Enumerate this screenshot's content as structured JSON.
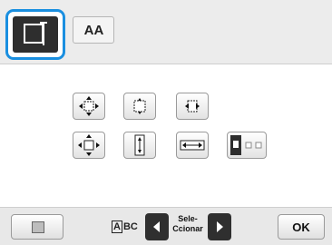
{
  "tabs": {
    "layout_tab": {
      "icon": "layout-frame-icon",
      "selected": true,
      "highlight_color": "#1a8fe0"
    },
    "font_tab": {
      "label": "AA",
      "icon": "font-style-icon"
    }
  },
  "edit_buttons": [
    {
      "name": "move-center-button",
      "icon": "move-all-directions-icon"
    },
    {
      "name": "move-horizontal-button",
      "icon": "move-left-right-icon"
    },
    {
      "name": "move-horizontal-button-2",
      "icon": "move-left-right-icon"
    },
    {
      "name": "expand-all-button",
      "icon": "expand-all-directions-icon"
    },
    {
      "name": "stretch-vertical-button",
      "icon": "stretch-vertical-icon"
    },
    {
      "name": "stretch-horizontal-button",
      "icon": "stretch-horizontal-icon"
    },
    {
      "name": "array-button",
      "icon": "array-arrange-icon"
    }
  ],
  "bottom": {
    "abc_a": "A",
    "abc_bc": "BC",
    "select_line1": "Sele-",
    "select_line2": "Ccionar",
    "ok_label": "OK"
  }
}
